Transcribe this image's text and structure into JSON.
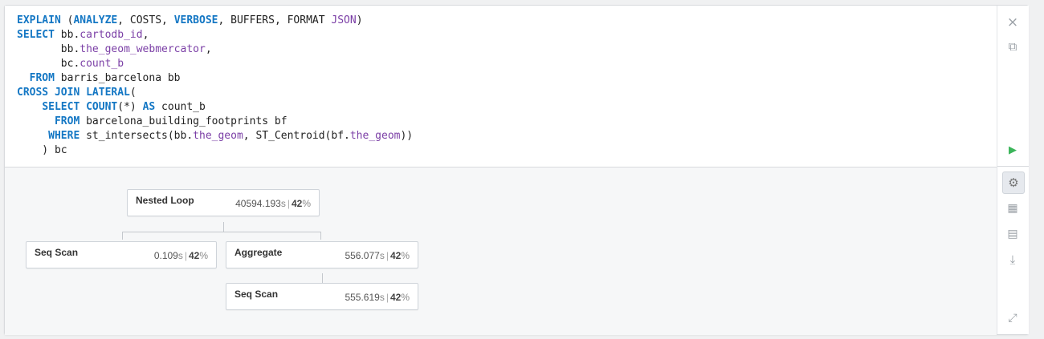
{
  "query": {
    "lines": [
      [
        {
          "t": "EXPLAIN",
          "c": "kw"
        },
        {
          "t": " (",
          "c": "plain"
        },
        {
          "t": "ANALYZE",
          "c": "kw"
        },
        {
          "t": ", COSTS, ",
          "c": "plain"
        },
        {
          "t": "VERBOSE",
          "c": "kw"
        },
        {
          "t": ", BUFFERS, FORMAT ",
          "c": "plain"
        },
        {
          "t": "JSON",
          "c": "at"
        },
        {
          "t": ")",
          "c": "plain"
        }
      ],
      [
        {
          "t": "SELECT",
          "c": "kw"
        },
        {
          "t": " bb.",
          "c": "plain"
        },
        {
          "t": "cartodb_id",
          "c": "at"
        },
        {
          "t": ",",
          "c": "plain"
        }
      ],
      [
        {
          "t": "       bb.",
          "c": "plain"
        },
        {
          "t": "the_geom_webmercator",
          "c": "at"
        },
        {
          "t": ",",
          "c": "plain"
        }
      ],
      [
        {
          "t": "       bc.",
          "c": "plain"
        },
        {
          "t": "count_b",
          "c": "at"
        }
      ],
      [
        {
          "t": "  ",
          "c": "plain"
        },
        {
          "t": "FROM",
          "c": "kw"
        },
        {
          "t": " barris_barcelona bb",
          "c": "plain"
        }
      ],
      [
        {
          "t": "CROSS JOIN LATERAL",
          "c": "kw"
        },
        {
          "t": "(",
          "c": "plain"
        }
      ],
      [
        {
          "t": "    ",
          "c": "plain"
        },
        {
          "t": "SELECT",
          "c": "kw"
        },
        {
          "t": " ",
          "c": "plain"
        },
        {
          "t": "COUNT",
          "c": "kw"
        },
        {
          "t": "(*) ",
          "c": "plain"
        },
        {
          "t": "AS",
          "c": "kw"
        },
        {
          "t": " count_b",
          "c": "plain"
        }
      ],
      [
        {
          "t": "      ",
          "c": "plain"
        },
        {
          "t": "FROM",
          "c": "kw"
        },
        {
          "t": " barcelona_building_footprints bf",
          "c": "plain"
        }
      ],
      [
        {
          "t": "     ",
          "c": "plain"
        },
        {
          "t": "WHERE",
          "c": "kw"
        },
        {
          "t": " st_intersects(bb.",
          "c": "plain"
        },
        {
          "t": "the_geom",
          "c": "at"
        },
        {
          "t": ", ST_Centroid(bf.",
          "c": "plain"
        },
        {
          "t": "the_geom",
          "c": "at"
        },
        {
          "t": "))",
          "c": "plain"
        }
      ],
      [
        {
          "t": "    ) bc",
          "c": "plain"
        }
      ]
    ]
  },
  "plan": {
    "nodes": [
      {
        "id": "nested-loop",
        "name": "Nested Loop",
        "time": "40594.193",
        "unit": "s",
        "pct": "42",
        "pct_sign": "%"
      },
      {
        "id": "seq-scan-1",
        "name": "Seq Scan",
        "time": "0.109",
        "unit": "s",
        "pct": "42",
        "pct_sign": "%"
      },
      {
        "id": "aggregate",
        "name": "Aggregate",
        "time": "556.077",
        "unit": "s",
        "pct": "42",
        "pct_sign": "%"
      },
      {
        "id": "seq-scan-2",
        "name": "Seq Scan",
        "time": "555.619",
        "unit": "s",
        "pct": "42",
        "pct_sign": "%"
      }
    ],
    "separator": "|"
  },
  "toolbar": {
    "close_icon": "×",
    "copy_icon": "⧉",
    "run_icon": "▶",
    "settings_icon": "⚙",
    "table_icon": "▦",
    "card_icon": "▤",
    "download_icon": "⤓",
    "expand_icon": "⤢",
    "run_color": "#3bb55a"
  }
}
